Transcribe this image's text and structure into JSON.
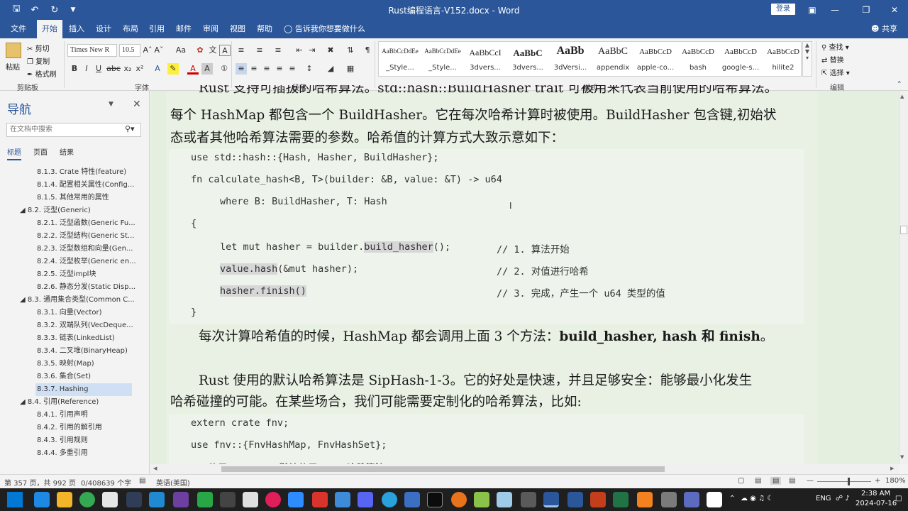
{
  "window": {
    "title": "Rust编程语言-V152.docx - Word",
    "login_label": "登录",
    "quick_access": [
      "save-icon",
      "undo-icon",
      "redo-icon",
      "customize-icon"
    ]
  },
  "tabs": [
    "文件",
    "开始",
    "插入",
    "设计",
    "布局",
    "引用",
    "邮件",
    "审阅",
    "视图",
    "帮助"
  ],
  "active_tab": "开始",
  "tell_me": "告诉我你想要做什么",
  "share": "共享",
  "ribbon": {
    "clipboard": {
      "paste": "粘贴",
      "cut": "剪切",
      "copy": "复制",
      "format_painter": "格式刷",
      "label": "剪贴板"
    },
    "font": {
      "name": "Times New R",
      "size": "10.5",
      "label": "字体",
      "bold": "B",
      "italic": "I",
      "underline": "U",
      "strike": "abc",
      "sub": "x₂",
      "sup": "x²"
    },
    "paragraph": {
      "label": "段落"
    },
    "styles": {
      "label": "样式",
      "items": [
        {
          "preview": "AaBbCcDdEe",
          "name": "_Style..."
        },
        {
          "preview": "AaBbCcDdEe",
          "name": "_Style..."
        },
        {
          "preview": "AaBbCcI",
          "name": "3dvers..."
        },
        {
          "preview": "AaBbC",
          "name": "3dvers..."
        },
        {
          "preview": "AaBb",
          "name": "3dVersi..."
        },
        {
          "preview": "AaBbC",
          "name": "appendix"
        },
        {
          "preview": "AaBbCcD",
          "name": "apple-co..."
        },
        {
          "preview": "AaBbCcD",
          "name": "bash"
        },
        {
          "preview": "AaBbCcD",
          "name": "google-s..."
        },
        {
          "preview": "AaBbCcD",
          "name": "hilite2"
        }
      ]
    },
    "editing": {
      "find": "查找",
      "replace": "替换",
      "select": "选择",
      "label": "编辑"
    }
  },
  "nav": {
    "title": "导航",
    "search_placeholder": "在文档中搜索",
    "tabs": [
      "标题",
      "页面",
      "结果"
    ],
    "items": [
      {
        "text": "8.1.3. Crate 特性(feature)",
        "level": 3
      },
      {
        "text": "8.1.4. 配置相关属性(Config...",
        "level": 3
      },
      {
        "text": "8.1.5. 其他常用的属性",
        "level": 3
      },
      {
        "text": "8.2. 泛型(Generic)",
        "level": 2
      },
      {
        "text": "8.2.1. 泛型函数(Generic Fu...",
        "level": 3
      },
      {
        "text": "8.2.2. 泛型结构(Generic St...",
        "level": 3
      },
      {
        "text": "8.2.3. 泛型数组和向量(Gen...",
        "level": 3
      },
      {
        "text": "8.2.4. 泛型枚举(Generic en...",
        "level": 3
      },
      {
        "text": "8.2.5. 泛型impl块",
        "level": 3
      },
      {
        "text": "8.2.6. 静态分发(Static Disp...",
        "level": 3
      },
      {
        "text": "8.3. 通用集合类型(Common C...",
        "level": 2
      },
      {
        "text": "8.3.1. 向量(Vector)",
        "level": 3
      },
      {
        "text": "8.3.2. 双端队列(VecDeque...",
        "level": 3
      },
      {
        "text": "8.3.3. 链表(LinkedList)",
        "level": 3
      },
      {
        "text": "8.3.4. 二叉堆(BinaryHeap)",
        "level": 3
      },
      {
        "text": "8.3.5. 映射(Map)",
        "level": 3
      },
      {
        "text": "8.3.6. 集合(Set)",
        "level": 3
      },
      {
        "text": "8.3.7. Hashing",
        "level": 3,
        "selected": true
      },
      {
        "text": "8.4. 引用(Reference)",
        "level": 2
      },
      {
        "text": "8.4.1. 引用声明",
        "level": 3
      },
      {
        "text": "8.4.2. 引用的解引用",
        "level": 3
      },
      {
        "text": "8.4.3. 引用规则",
        "level": 3
      },
      {
        "text": "8.4.4. 多重引用",
        "level": 3
      }
    ]
  },
  "document": {
    "para1_line0": "Rust 支持可插拔的哈希算法。std::hash::BuildHasher trait 可被用来代表当前使用的哈希算法。",
    "para1_line1": "每个 HashMap 都包含一个 BuildHasher。它在每次哈希计算时被使用。BuildHasher 包含键,初始状",
    "para1_line2": "态或者其他哈希算法需要的参数。哈希值的计算方式大致示意如下：",
    "code1": {
      "l1": "use std::hash::{Hash, Hasher, BuildHasher};",
      "l2": "fn calculate_hash<B, T>(builder: &B, value: &T) -> u64",
      "l3": "where B: BuildHasher, T: Hash",
      "l4": "{",
      "l5a": "let mut hasher = builder.",
      "l5b": "build_hasher",
      "l5c": "();",
      "c5": "// 1. 算法开始",
      "l6a": "value.hash",
      "l6b": "(&mut hasher);",
      "c6": "// 2. 对值进行哈希",
      "l7": "hasher.finish()",
      "c7": "// 3. 完成，产生一个 u64 类型的值",
      "l8": "}"
    },
    "para2_a": "每次计算哈希值的时候，HashMap 都会调用上面 3 个方法：",
    "para2_b": "build_hasher, hash 和 finish",
    "para2_c": "。",
    "para3_line1": "Rust 使用的默认哈希算法是 SipHash-1-3。它的好处是快速，并且足够安全：能够最小化发生",
    "para3_line2": "哈希碰撞的可能。在某些场合，我们可能需要定制化的哈希算法，比如:",
    "code2": {
      "l1": "extern crate fnv;",
      "l2": "use fnv::{FnvHashMap, FnvHashSet};",
      "l3": "// 使用 FNV ... 默认使用 ... 哈希算法"
    }
  },
  "status": {
    "page": "第 357 页，共 992 页",
    "words": "0/408639 个字",
    "lang": "英语(美国)",
    "zoom": "180%"
  },
  "taskbar": {
    "time": "2:38 AM",
    "date": "2024-07-16",
    "lang": "ENG"
  }
}
